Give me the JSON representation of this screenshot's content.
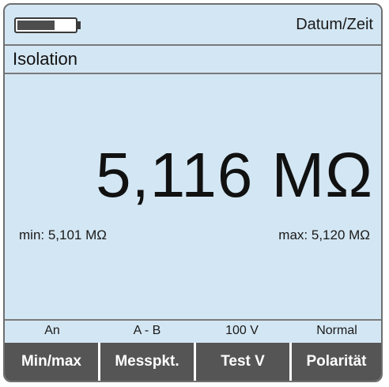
{
  "status": {
    "battery_icon": "battery-icon",
    "battery_level": 0.65,
    "datetime_label": "Datum/Zeit"
  },
  "mode": {
    "label": "Isolation"
  },
  "measurement": {
    "value": "5,116 MΩ",
    "min": "min: 5,101 MΩ",
    "max": "max: 5,120 MΩ"
  },
  "softkeys": [
    {
      "state": "An",
      "label": "Min/max"
    },
    {
      "state": "A - B",
      "label": "Messpkt."
    },
    {
      "state": "100 V",
      "label": "Test V"
    },
    {
      "state": "Normal",
      "label": "Polarität"
    }
  ],
  "colors": {
    "screen_bg": "#d3e6f3",
    "key_bg": "#555555",
    "key_text": "#ffffff"
  }
}
